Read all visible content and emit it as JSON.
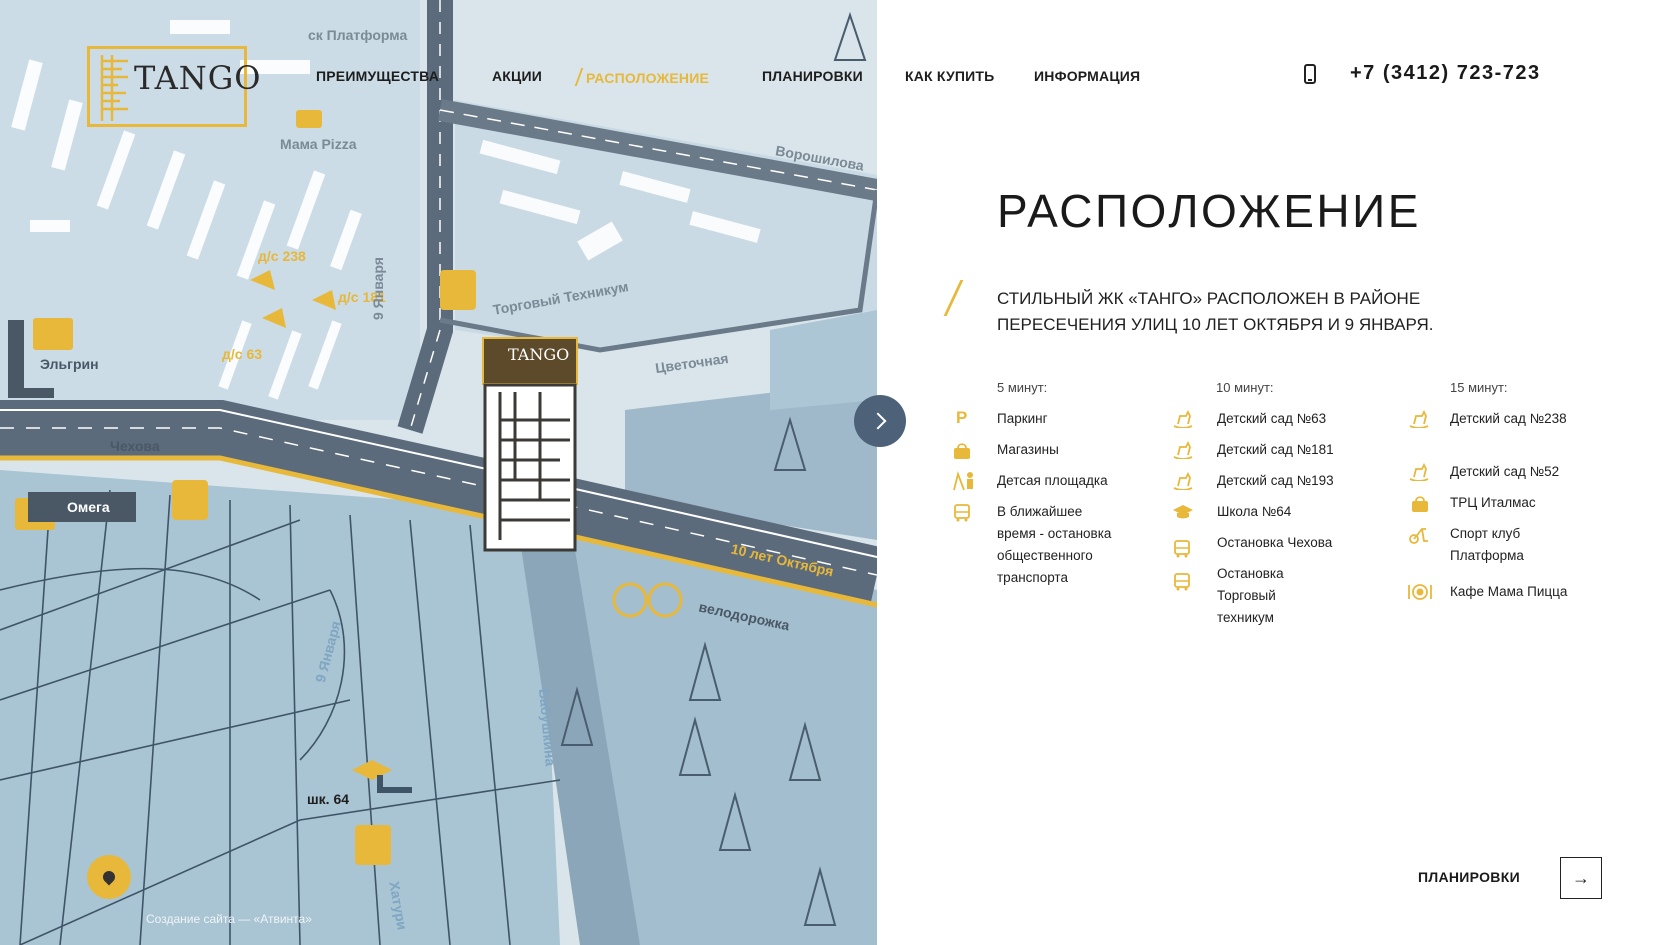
{
  "header": {
    "logo_text": "TANGO",
    "nav": [
      {
        "label": "ПРЕИМУЩЕСТВА",
        "active": false
      },
      {
        "label": "АКЦИИ",
        "active": false
      },
      {
        "label": "РАСПОЛОЖЕНИЕ",
        "active": true
      },
      {
        "label": "ПЛАНИРОВКИ",
        "active": false
      },
      {
        "label": "КАК КУПИТЬ",
        "active": false
      },
      {
        "label": "ИНФОРМАЦИЯ",
        "active": false
      }
    ],
    "phone": "+7 (3412) 723-723"
  },
  "map": {
    "labels": {
      "platforma": "ск Платформа",
      "mama_pizza": "Мама  Pizza",
      "voroshilova": "Ворошилова",
      "ds238": "д/с 238",
      "ds181": "д/с 181",
      "ds63": "д/с 63",
      "elgrin": "Эльгрин",
      "jan9_top": "9 Января",
      "torgovy": "Торговый Техникум",
      "tsvetochnaya": "Цветочная",
      "chekhova": "Чехова",
      "omega": "Омега",
      "oct10": "10 лет Октября",
      "velodorozhka": "велодорожка",
      "jan9_bottom": "9 Января",
      "babushkina": "Бабушкина",
      "school64": "шк. 64",
      "khaturina": "Хатури",
      "tango_pin": "TANGO"
    },
    "credit": "Создание сайта — «Атвинта»"
  },
  "content": {
    "title": "РАСПОЛОЖЕНИЕ",
    "lead": "СТИЛЬНЫЙ ЖК «ТАНГО» РАСПОЛОЖЕН В РАЙОНЕ ПЕРЕСЕЧЕНИЯ УЛИЦ 10 ЛЕТ ОКТЯБРЯ И 9 ЯНВАРЯ.",
    "columns": [
      {
        "heading": "5 минут:",
        "items": [
          {
            "icon": "parking-icon",
            "label": "Паркинг"
          },
          {
            "icon": "shopping-bag-icon",
            "label": "Магазины"
          },
          {
            "icon": "playground-icon",
            "label": "Детсая площадка"
          },
          {
            "icon": "bus-icon",
            "label": "В ближайшее время - остановка общественного транспорта"
          }
        ]
      },
      {
        "heading": "10 минут:",
        "items": [
          {
            "icon": "rocking-horse-icon",
            "label": "Детский сад  №63"
          },
          {
            "icon": "rocking-horse-icon",
            "label": "Детский сад  №181"
          },
          {
            "icon": "rocking-horse-icon",
            "label": "Детский сад  №193"
          },
          {
            "icon": "graduation-cap-icon",
            "label": "Школа №64"
          },
          {
            "icon": "bus-icon",
            "label": "Остановка Чехова"
          },
          {
            "icon": "bus-icon",
            "label": "Остановка Торговый техникум"
          }
        ]
      },
      {
        "heading": "15 минут:",
        "items": [
          {
            "icon": "rocking-horse-icon",
            "label": "Детский сад №238"
          },
          {
            "icon": "rocking-horse-icon",
            "label": "Детский сад  №52"
          },
          {
            "icon": "shopping-bag-icon",
            "label": "ТРЦ  Италмас"
          },
          {
            "icon": "exercise-bike-icon",
            "label": "Спорт клуб Платформа"
          },
          {
            "icon": "cafe-icon",
            "label": "Кафе Мама Пицца"
          }
        ]
      }
    ]
  },
  "footer": {
    "plan_link": "ПЛАНИРОВКИ",
    "arrow": "→"
  },
  "colors": {
    "accent": "#e8b83a",
    "road": "#5c6b7c",
    "map_bg": "#d9e5eb",
    "map_block": "#a7c2d1",
    "button_dark": "#4d6178"
  }
}
